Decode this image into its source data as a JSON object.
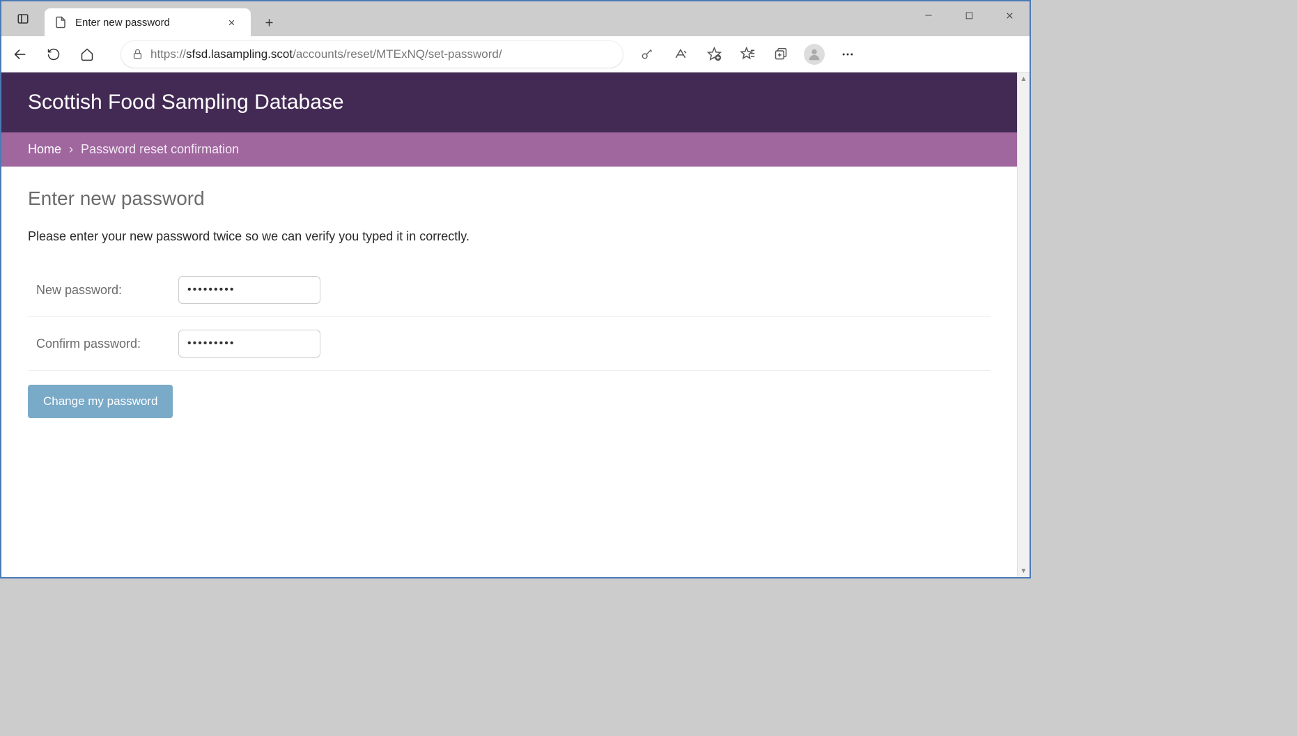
{
  "browser": {
    "tab_title": "Enter new password",
    "url_scheme": "https://",
    "url_host": "sfsd.lasampling.scot",
    "url_path": "/accounts/reset/MTExNQ/set-password/"
  },
  "site": {
    "title": "Scottish Food Sampling Database"
  },
  "breadcrumb": {
    "home": "Home",
    "separator": "›",
    "current": "Password reset confirmation"
  },
  "page": {
    "heading": "Enter new password",
    "instruction": "Please enter your new password twice so we can verify you typed it in correctly.",
    "new_password_label": "New password:",
    "confirm_password_label": "Confirm password:",
    "new_password_value": "•••••••••",
    "confirm_password_value": "•••••••••",
    "submit_label": "Change my password"
  }
}
